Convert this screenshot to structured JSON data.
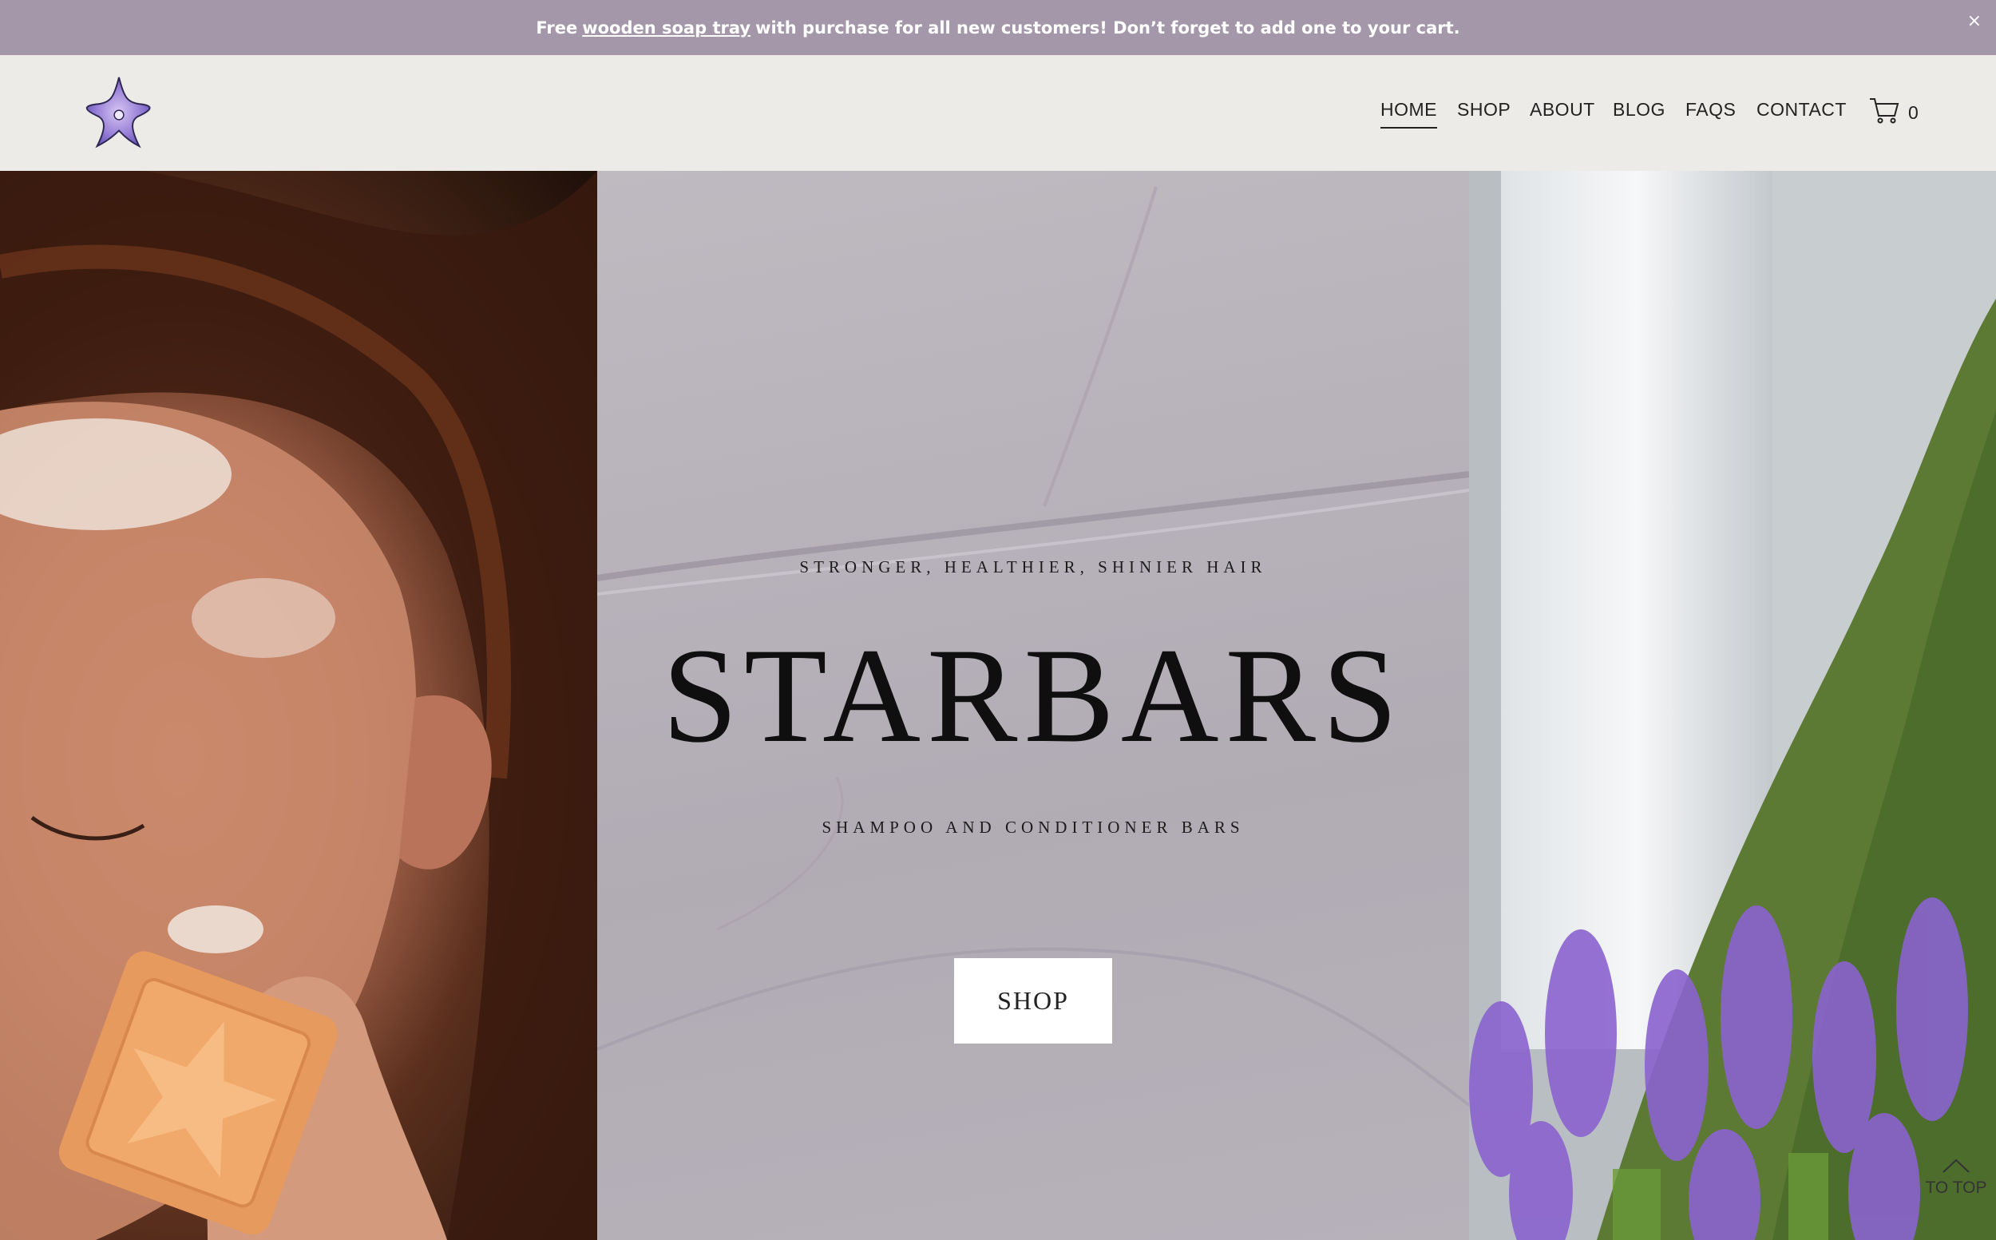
{
  "announcement": {
    "prefix": "Free",
    "link": "wooden soap tray",
    "suffix": "with purchase for all new customers! Don’t forget to add one to your cart.",
    "close": "×"
  },
  "header": {
    "logo_icon": "flower-star-icon",
    "nav": [
      {
        "label": "HOME",
        "active": true
      },
      {
        "label": "SHOP"
      },
      {
        "label": "ABOUT"
      },
      {
        "label": "BLOG"
      },
      {
        "label": "FAQS"
      },
      {
        "label": "CONTACT"
      }
    ],
    "cart_icon": "cart-icon",
    "cart_count": "0"
  },
  "hero": {
    "tagline_top": "STRONGER, HEALTHIER, SHINIER HAIR",
    "brand": "STARBARS",
    "tagline_bottom": "SHAMPOO AND CONDITIONER BARS",
    "shop_button": "SHOP",
    "left_image": "woman-with-soap-bar-photo",
    "right_image": "waterfall-lupine-photo"
  },
  "to_top": "TO TOP",
  "colors": {
    "announce_bg": "#a497aa",
    "header_bg": "#ecebe7",
    "hero_center_bg": "#b6b0b9"
  }
}
